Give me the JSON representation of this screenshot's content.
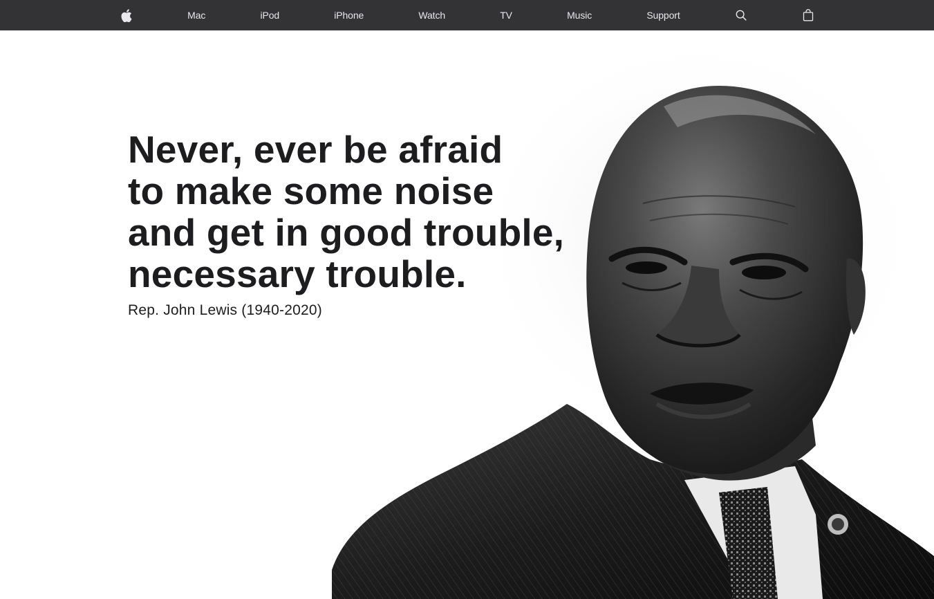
{
  "nav": {
    "logo_icon": "apple-logo-icon",
    "items": [
      {
        "label": "Mac"
      },
      {
        "label": "iPod"
      },
      {
        "label": "iPhone"
      },
      {
        "label": "Watch"
      },
      {
        "label": "TV"
      },
      {
        "label": "Music"
      },
      {
        "label": "Support"
      }
    ],
    "search_icon": "search-icon",
    "bag_icon": "shopping-bag-icon",
    "background_color": "#333336",
    "text_color": "#e8e8ed"
  },
  "hero": {
    "quote_lines": [
      "Never, ever be afraid",
      "to make some noise",
      "and get in good trouble,",
      "necessary trouble."
    ],
    "attribution": "Rep. John Lewis (1940-2020)",
    "text_color": "#1d1d1f",
    "portrait": "black-and-white portrait photo"
  }
}
